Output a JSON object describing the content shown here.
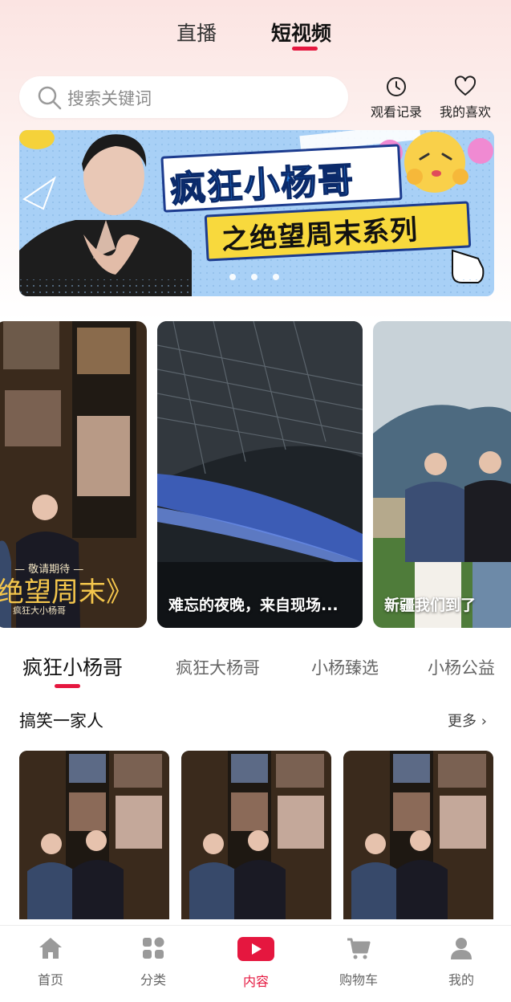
{
  "top_tabs": {
    "live": "直播",
    "short_video": "短视频"
  },
  "search": {
    "placeholder": "搜索关键词"
  },
  "quick_actions": {
    "history": "观看记录",
    "favorites": "我的喜欢"
  },
  "banner": {
    "title": "疯狂小杨哥",
    "subtitle": "之绝望周末系列",
    "page_count": 3,
    "active_page": 1
  },
  "feature_cards": [
    {
      "caption": "",
      "title": "绝望周末》",
      "small_top": "— 敬请期待 —",
      "small_bottom": "疯狂大小杨哥"
    },
    {
      "caption": "难忘的夜晚，来自现场..."
    },
    {
      "caption": "新疆我们到了"
    }
  ],
  "category_tabs": [
    "疯狂小杨哥",
    "疯狂大杨哥",
    "小杨臻选",
    "小杨公益"
  ],
  "active_category": "疯狂小杨哥",
  "section": {
    "title": "搞笑一家人",
    "more": "更多 ›"
  },
  "bottom_nav": [
    {
      "label": "首页",
      "icon": "home-icon"
    },
    {
      "label": "分类",
      "icon": "grid-icon"
    },
    {
      "label": "内容",
      "icon": "video-play-icon"
    },
    {
      "label": "购物车",
      "icon": "cart-icon"
    },
    {
      "label": "我的",
      "icon": "user-icon"
    }
  ],
  "active_nav": "内容",
  "colors": {
    "accent": "#e5173f",
    "inactive_icon": "#9a9a9a"
  }
}
